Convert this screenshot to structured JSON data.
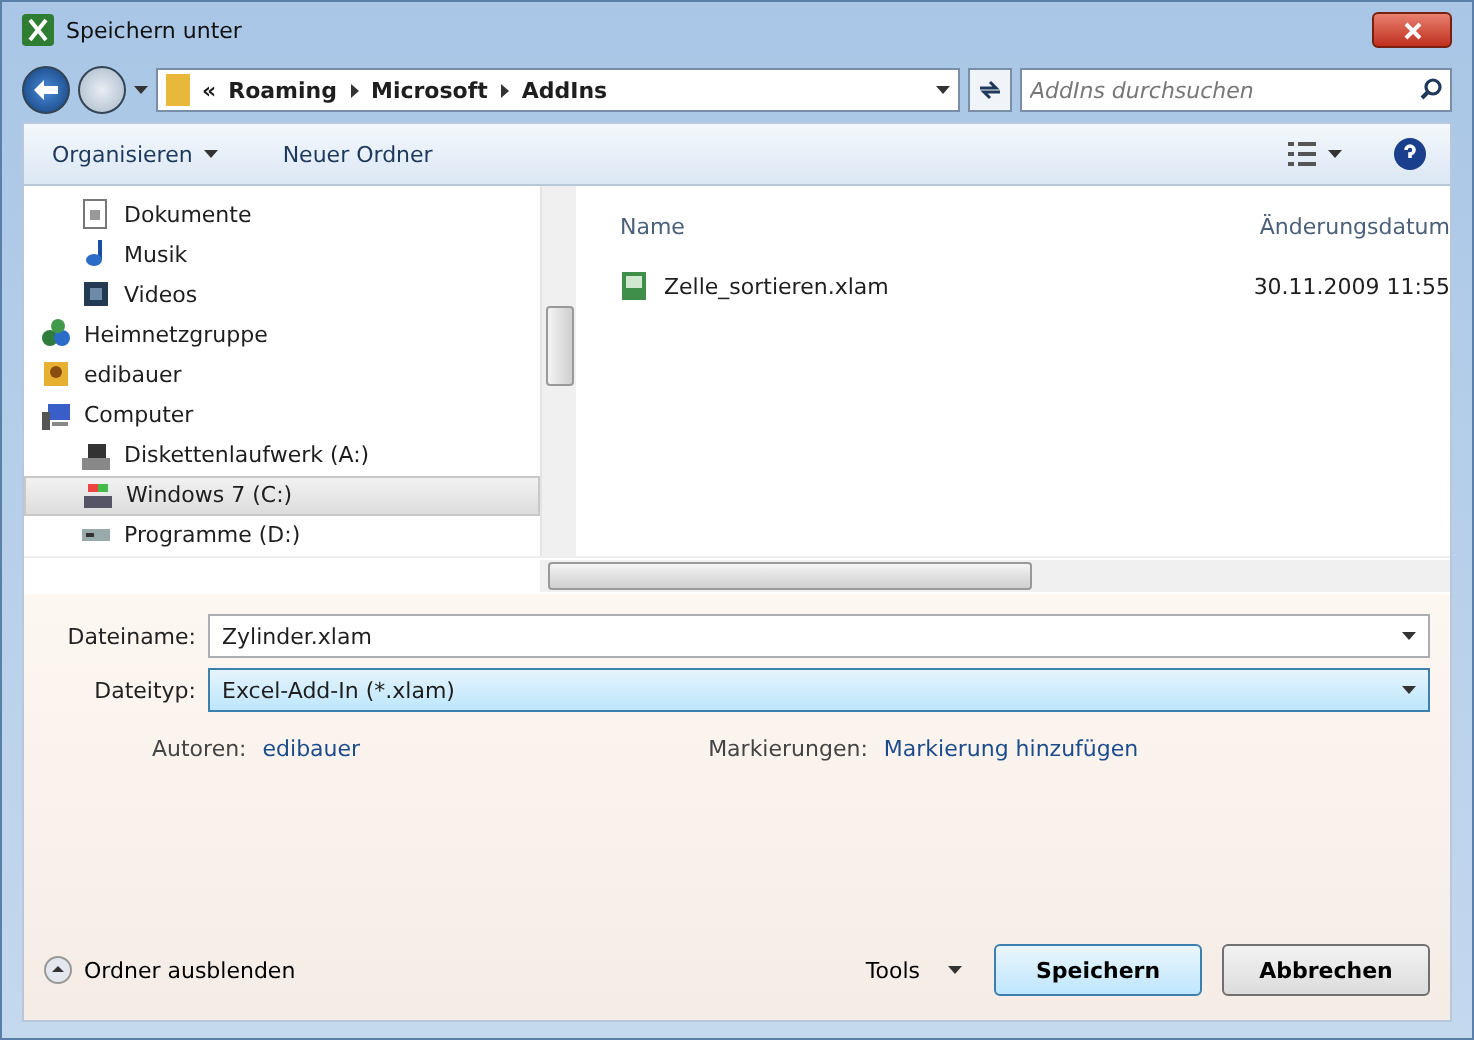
{
  "window": {
    "title": "Speichern unter"
  },
  "address": {
    "overflow": "«",
    "crumbs": [
      "Roaming",
      "Microsoft",
      "AddIns"
    ]
  },
  "search": {
    "placeholder": "AddIns durchsuchen"
  },
  "toolbar": {
    "organize": "Organisieren",
    "new_folder": "Neuer Ordner"
  },
  "nav": {
    "items": [
      {
        "children": [
          {
            "label": "Dokumente",
            "kind": "document",
            "selected": false
          },
          {
            "label": "Musik",
            "kind": "music",
            "selected": false
          },
          {
            "label": "Videos",
            "kind": "video",
            "selected": false
          }
        ]
      },
      {
        "label": "Heimnetzgruppe",
        "kind": "network",
        "selected": false
      },
      {
        "label": "edibauer",
        "kind": "user",
        "selected": false
      },
      {
        "label": "Computer",
        "kind": "computer",
        "selected": false,
        "children": [
          {
            "label": "Diskettenlaufwerk (A:)",
            "kind": "floppy",
            "selected": false
          },
          {
            "label": "Windows 7 (C:)",
            "kind": "system-drive",
            "selected": true
          },
          {
            "label": "Programme (D:)",
            "kind": "drive",
            "selected": false
          }
        ]
      }
    ]
  },
  "files": {
    "columns": [
      "Name",
      "Änderungsdatum"
    ],
    "rows": [
      {
        "name": "Zelle_sortieren.xlam",
        "date": "30.11.2009 11:55"
      }
    ]
  },
  "form": {
    "filename_label": "Dateiname:",
    "filename": "Zylinder.xlam",
    "type_label": "Dateityp:",
    "type": "Excel-Add-In (*.xlam)",
    "authors_label": "Autoren:",
    "authors": "edibauer",
    "tags_label": "Markierungen:",
    "tags": "Markierung hinzufügen"
  },
  "footer": {
    "hide_folders": "Ordner ausblenden",
    "tools": "Tools",
    "save": "Speichern",
    "cancel": "Abbrechen"
  }
}
